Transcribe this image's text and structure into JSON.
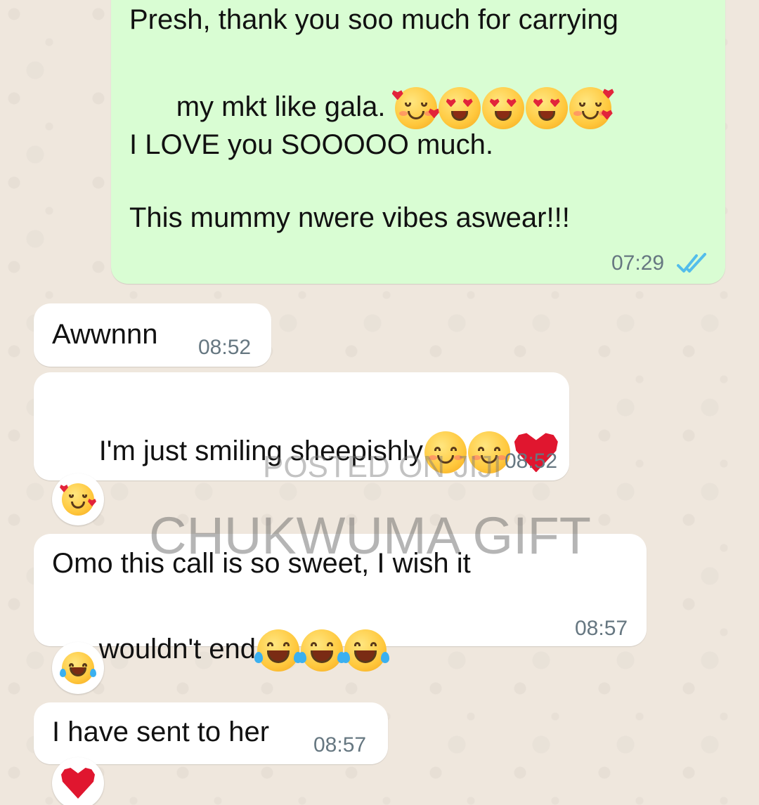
{
  "messages": [
    {
      "direction": "outgoing",
      "lines": [
        "Presh, thank you soo much for carrying",
        "my mkt like gala. "
      ],
      "line3": "I LOVE you SOOOOO much.",
      "line4": "This mummy nwere vibes aswear!!!",
      "emojis": [
        "smiling-face-with-hearts",
        "heart-eyes",
        "heart-eyes",
        "heart-eyes",
        "smiling-face-with-hearts"
      ],
      "time": "07:29",
      "status": "read"
    },
    {
      "direction": "incoming",
      "text": "Awwnnn",
      "time": "08:52"
    },
    {
      "direction": "incoming",
      "text": "I'm just smiling sheepishly",
      "emojis": [
        "smiling-face",
        "smiling-face",
        "red-heart"
      ],
      "time": "08:52",
      "reaction": "smiling-face-with-hearts"
    },
    {
      "direction": "incoming",
      "line1": "Omo this call is so sweet, I wish it",
      "line2": "wouldn't end",
      "emojis": [
        "tears-of-joy",
        "tears-of-joy",
        "tears-of-joy"
      ],
      "time": "08:57",
      "reaction": "tears-of-joy"
    },
    {
      "direction": "incoming",
      "text": "I have sent to her",
      "time": "08:57",
      "reaction": "red-heart"
    }
  ],
  "watermarks": {
    "posted": "POSTED ON JIJI",
    "owner": "CHUKWUMA GIFT"
  },
  "colors": {
    "outgoing_bubble": "#d9fdd3",
    "incoming_bubble": "#ffffff",
    "read_ticks": "#53bdeb",
    "wallpaper": "#efe7dd",
    "timestamp": "#667781"
  }
}
